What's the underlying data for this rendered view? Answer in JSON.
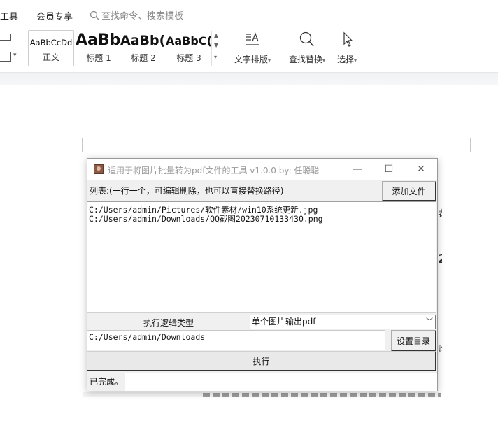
{
  "menu": {
    "tools_label": "工具",
    "member_label": "会员专享",
    "search_placeholder": "查找命令、搜索模板"
  },
  "ribbon": {
    "styles": [
      {
        "sample": "AaBbCcDd",
        "name": "正文"
      },
      {
        "sample": "AaBb",
        "name": "标题 1"
      },
      {
        "sample": "AaBb(",
        "name": "标题 2"
      },
      {
        "sample": "AaBbC(",
        "name": "标题 3"
      }
    ],
    "text_layout_label": "文字排版",
    "find_replace_label": "查找替换",
    "select_label": "选择"
  },
  "dialog": {
    "title": "适用于将图片批量转为pdf文件的工具 v1.0.0    by: 任聪聪",
    "list_label": "列表:(一行一个，可编辑删除，也可以直接替换路径)",
    "add_file_button": "添加文件",
    "files": [
      "C:/Users/admin/Pictures/软件素材/win10系统更新.jpg",
      "C:/Users/admin/Downloads/QQ截图20230710133430.png"
    ],
    "logic_type_label": "执行逻辑类型",
    "logic_type_value": "单个图片输出pdf",
    "output_dir": "C:/Users/admin/Downloads",
    "set_dir_button": "设置目录",
    "execute_button": "执行",
    "status": "已完成。"
  }
}
